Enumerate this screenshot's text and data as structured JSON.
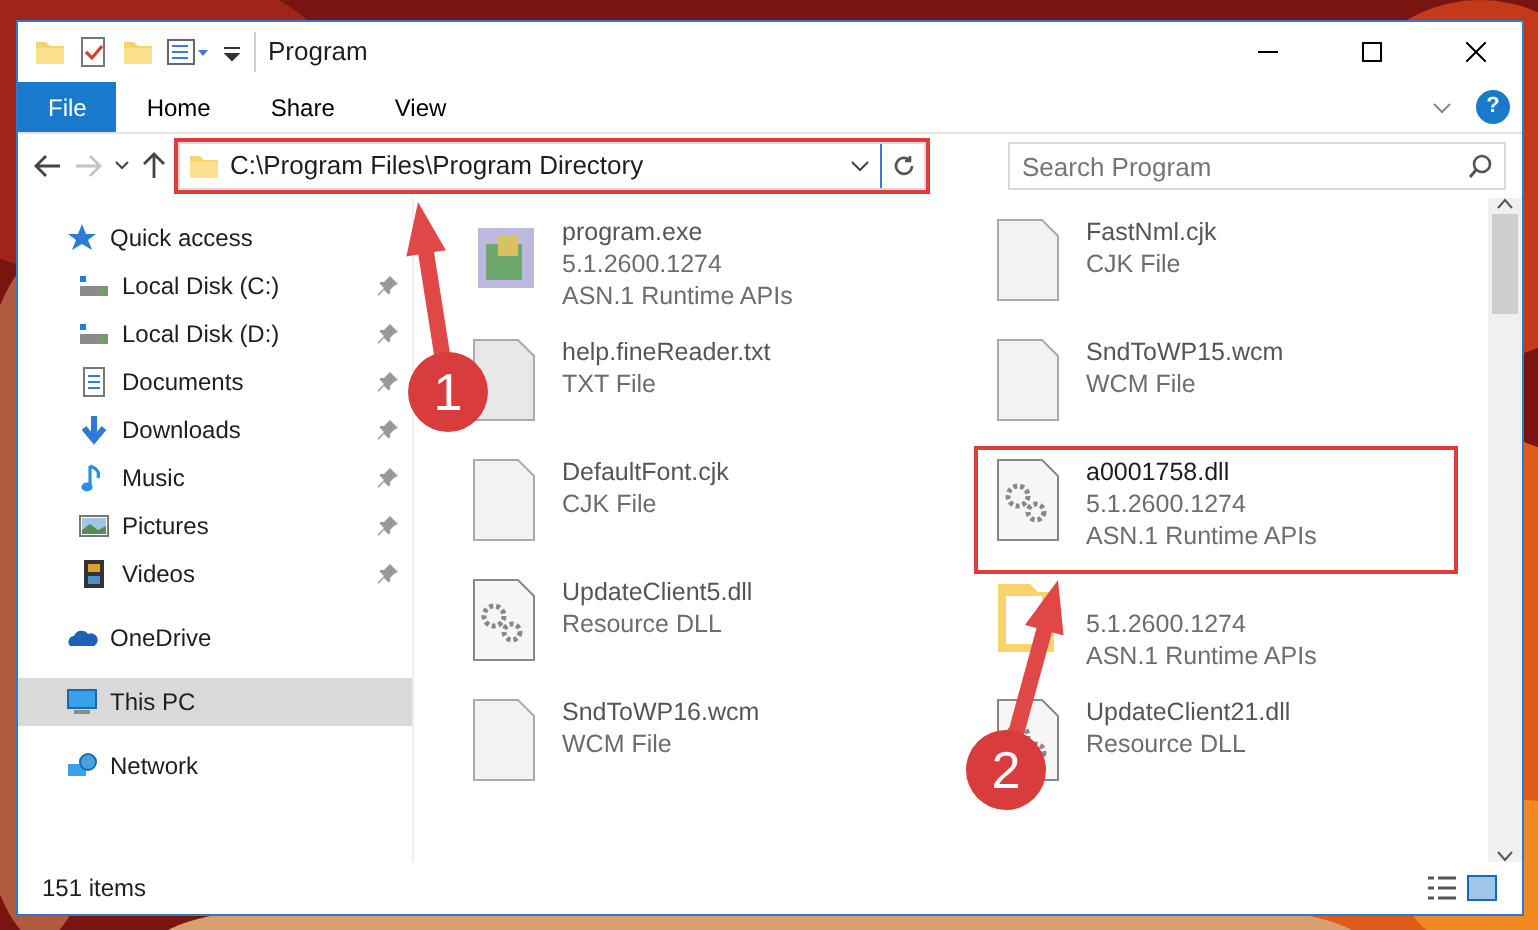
{
  "window": {
    "title": "Program"
  },
  "ribbon": {
    "tabs": [
      {
        "label": "File",
        "selected": true
      },
      {
        "label": "Home",
        "selected": false
      },
      {
        "label": "Share",
        "selected": false
      },
      {
        "label": "View",
        "selected": false
      }
    ],
    "help": "?"
  },
  "address": {
    "path": "C:\\Program Files\\Program Directory",
    "forward_disabled": true,
    "highlighted": true
  },
  "search": {
    "placeholder": "Search Program"
  },
  "sidebar": {
    "items": [
      {
        "label": "Quick access",
        "kind": "star",
        "selected": false,
        "children": [
          {
            "label": "Local Disk (C:)",
            "kind": "disk",
            "pinned": true,
            "selected": false
          },
          {
            "label": "Local Disk (D:)",
            "kind": "disk",
            "pinned": true,
            "selected": false
          },
          {
            "label": "Documents",
            "kind": "doc",
            "pinned": true,
            "selected": false
          },
          {
            "label": "Downloads",
            "kind": "download",
            "pinned": true,
            "selected": false
          },
          {
            "label": "Music",
            "kind": "music",
            "pinned": true,
            "selected": false
          },
          {
            "label": "Pictures",
            "kind": "pictures",
            "pinned": true,
            "selected": false
          },
          {
            "label": "Videos",
            "kind": "videos",
            "pinned": true,
            "selected": false
          }
        ]
      },
      {
        "label": "OneDrive",
        "kind": "cloud",
        "selected": false
      },
      {
        "label": "This PC",
        "kind": "pc",
        "selected": true
      },
      {
        "label": "Network",
        "kind": "network",
        "selected": false
      }
    ]
  },
  "files": [
    {
      "name": "program.exe",
      "details": [
        "5.1.2600.1274",
        "ASN.1 Runtime APIs"
      ],
      "kind": "exe",
      "highlighted": false
    },
    {
      "name": "FastNml.cjk",
      "details": [
        "CJK File"
      ],
      "kind": "blank",
      "highlighted": false
    },
    {
      "name": "help.fineReader.txt",
      "details": [
        "TXT File"
      ],
      "kind": "text",
      "highlighted": false
    },
    {
      "name": "SndToWP15.wcm",
      "details": [
        "WCM File"
      ],
      "kind": "blank",
      "highlighted": false
    },
    {
      "name": "DefaultFont.cjk",
      "details": [
        "CJK File"
      ],
      "kind": "blank",
      "highlighted": false
    },
    {
      "name": "a0001758.dll",
      "details": [
        "5.1.2600.1274",
        "ASN.1 Runtime APIs"
      ],
      "kind": "gears",
      "highlighted": true
    },
    {
      "name": "UpdateClient5.dll",
      "details": [
        "Resource DLL"
      ],
      "kind": "gears",
      "highlighted": false
    },
    {
      "details": [
        "5.1.2600.1274",
        "ASN.1 Runtime APIs"
      ],
      "kind": "folder",
      "highlighted": false
    },
    {
      "name": "SndToWP16.wcm",
      "details": [
        "WCM File"
      ],
      "kind": "blank",
      "highlighted": false
    },
    {
      "name": "UpdateClient21.dll",
      "details": [
        "Resource DLL"
      ],
      "kind": "gears",
      "highlighted": false
    }
  ],
  "status_bar": {
    "count": "151 items"
  },
  "annotations": [
    {
      "number": "1"
    },
    {
      "number": "2"
    }
  ]
}
